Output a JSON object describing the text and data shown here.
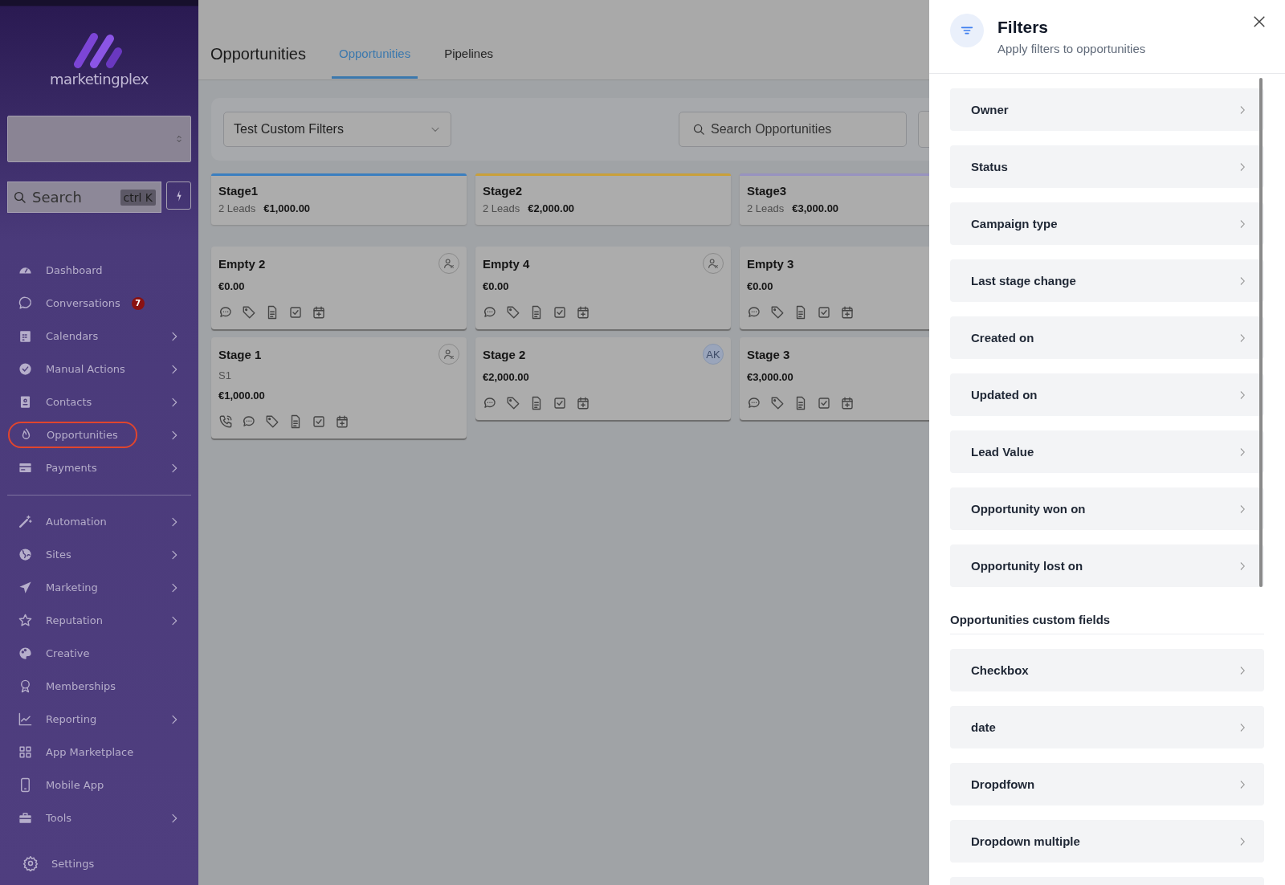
{
  "sidebar": {
    "brand": "marketingplex",
    "search": {
      "placeholder": "Search",
      "shortcut": "ctrl K"
    },
    "items": [
      {
        "label": "Dashboard",
        "has_submenu": false,
        "circled": false
      },
      {
        "label": "Conversations",
        "has_submenu": false,
        "circled": false,
        "badge": "7"
      },
      {
        "label": "Calendars",
        "has_submenu": true,
        "circled": false
      },
      {
        "label": "Manual Actions",
        "has_submenu": true,
        "circled": false
      },
      {
        "label": "Contacts",
        "has_submenu": true,
        "circled": false
      },
      {
        "label": "Opportunities",
        "has_submenu": true,
        "circled": true
      },
      {
        "label": "Payments",
        "has_submenu": true,
        "circled": false
      },
      {
        "label": "Automation",
        "has_submenu": true,
        "circled": false,
        "divider_before": true
      },
      {
        "label": "Sites",
        "has_submenu": true,
        "circled": false
      },
      {
        "label": "Marketing",
        "has_submenu": true,
        "circled": false
      },
      {
        "label": "Reputation",
        "has_submenu": true,
        "circled": false
      },
      {
        "label": "Creative",
        "has_submenu": false,
        "circled": false
      },
      {
        "label": "Memberships",
        "has_submenu": false,
        "circled": false
      },
      {
        "label": "Reporting",
        "has_submenu": true,
        "circled": false
      },
      {
        "label": "App Marketplace",
        "has_submenu": false,
        "circled": false
      },
      {
        "label": "Mobile App",
        "has_submenu": false,
        "circled": false
      },
      {
        "label": "Tools",
        "has_submenu": true,
        "circled": false
      }
    ],
    "settings": "Settings"
  },
  "header": {
    "title": "Opportunities",
    "tabs": [
      {
        "label": "Opportunities",
        "selected": true
      },
      {
        "label": "Pipelines",
        "selected": false
      }
    ]
  },
  "toolbar": {
    "pipeline": "Test Custom Filters",
    "search_placeholder": "Search Opportunities"
  },
  "stages": [
    {
      "name": "Stage1",
      "leads": "2 Leads",
      "value": "€1,000.00",
      "color": "#3b7fc0",
      "cards": [
        {
          "title": "Empty 2",
          "value": "€0.00",
          "assignee": {
            "kind": "unassigned"
          },
          "has_call": false
        },
        {
          "title": "Stage 1",
          "subtitle": "S1",
          "value": "€1,000.00",
          "assignee": {
            "kind": "unassigned"
          },
          "has_call": true
        }
      ]
    },
    {
      "name": "Stage2",
      "leads": "2 Leads",
      "value": "€2,000.00",
      "color": "#c9a03a",
      "cards": [
        {
          "title": "Empty 4",
          "value": "€0.00",
          "assignee": {
            "kind": "unassigned"
          },
          "has_call": false
        },
        {
          "title": "Stage 2",
          "value": "€2,000.00",
          "assignee": {
            "kind": "initials",
            "text": "AK"
          },
          "has_call": false
        }
      ]
    },
    {
      "name": "Stage3",
      "leads": "2 Leads",
      "value": "€3,000.00",
      "color": "#9893c0",
      "cards": [
        {
          "title": "Empty 3",
          "value": "€0.00",
          "has_call": false
        },
        {
          "title": "Stage 3",
          "value": "€3,000.00",
          "has_call": false
        }
      ]
    }
  ],
  "filters": {
    "title": "Filters",
    "subtitle": "Apply filters to opportunities",
    "items": [
      "Owner",
      "Status",
      "Campaign type",
      "Last stage change",
      "Created on",
      "Updated on",
      "Lead Value",
      "Opportunity won on",
      "Opportunity lost on"
    ],
    "custom_heading": "Opportunities custom fields",
    "custom_items": [
      "Checkbox",
      "date",
      "Dropdfown",
      "Dropdown multiple"
    ],
    "more_below": true
  }
}
